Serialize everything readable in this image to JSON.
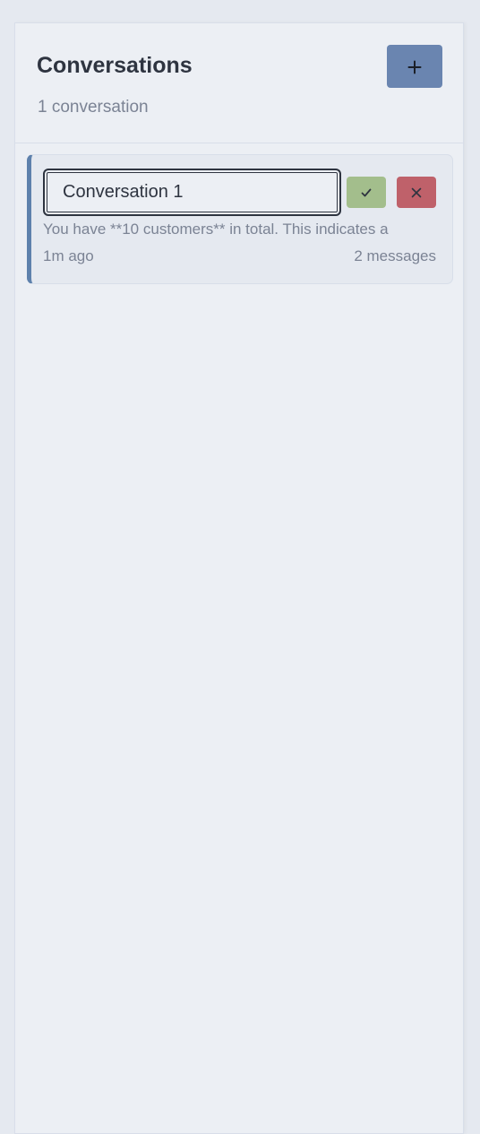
{
  "sidebar": {
    "title": "Conversations",
    "count_label": "1 conversation",
    "new_button_icon": "plus-icon",
    "conversations": [
      {
        "rename_value": "Conversation 1",
        "preview": "You have **10 customers** in total. This indicates a",
        "time_ago": "1m ago",
        "message_count": "2 messages",
        "confirm_icon": "check-icon",
        "cancel_icon": "close-icon"
      }
    ]
  },
  "colors": {
    "accent": "#5e81ac",
    "new_button": "#6a85b0",
    "confirm": "#a3be8c",
    "cancel": "#bf616a",
    "background": "#eceff4"
  }
}
